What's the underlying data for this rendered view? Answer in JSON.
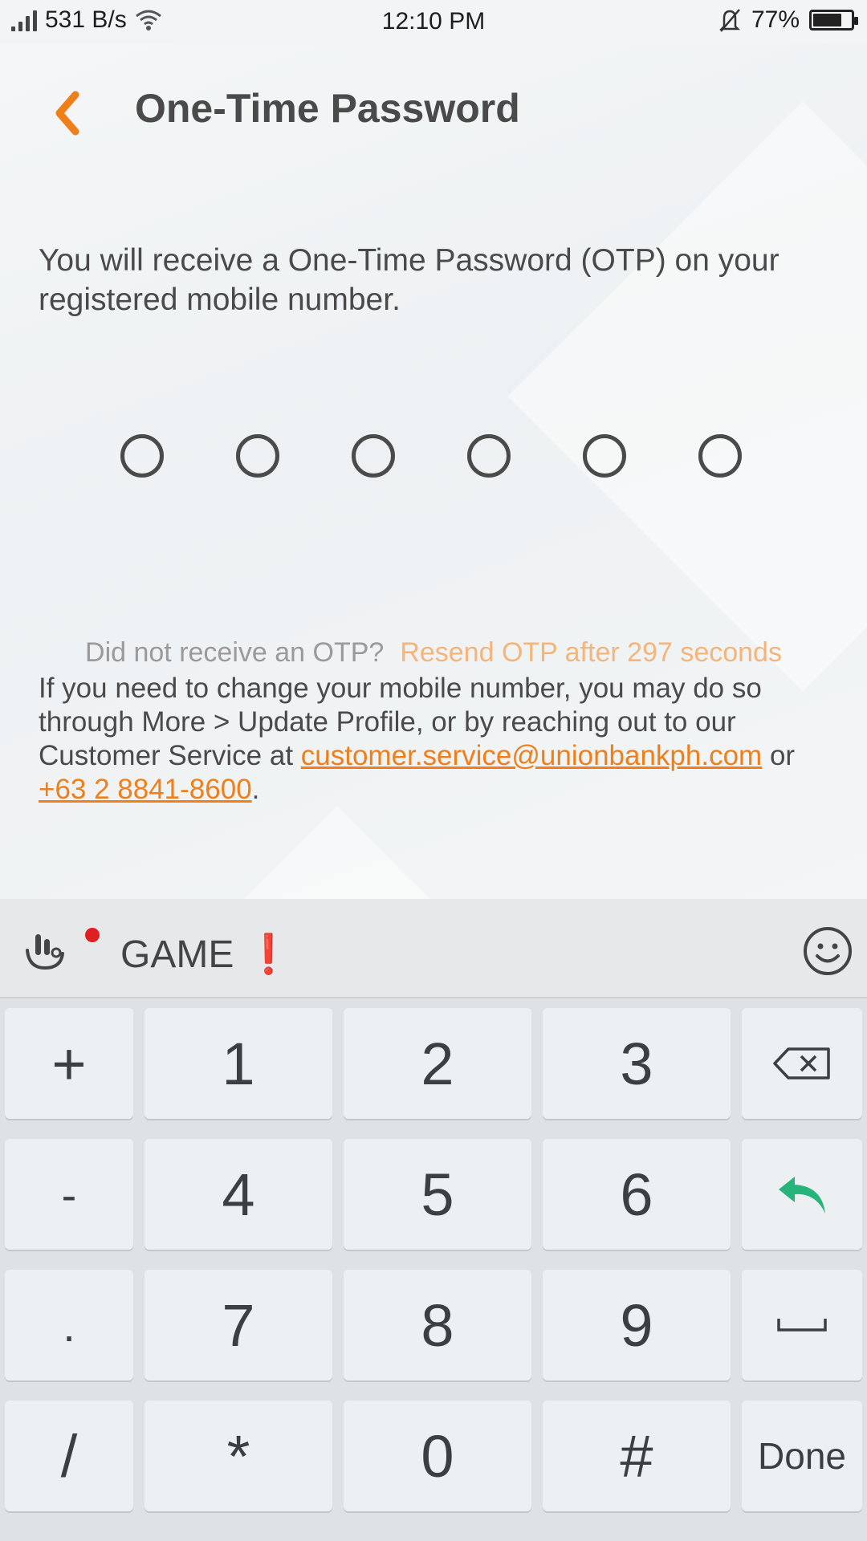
{
  "status_bar": {
    "network_speed": "531 B/s",
    "time": "12:10 PM",
    "battery_percent": "77%",
    "battery_level": 0.77
  },
  "header": {
    "title": "One-Time Password",
    "back_icon": "chevron-left-icon",
    "accent_color": "#f07f1a"
  },
  "intro": {
    "text": "You will receive a One-Time Password (OTP) on your registered mobile number."
  },
  "otp": {
    "length": 6,
    "filled": 0
  },
  "resend": {
    "question": "Did not receive an OTP?",
    "link": "Resend OTP after 297 seconds"
  },
  "info": {
    "text_before": "If you need to change your mobile number, you may do so through More > Update Profile, or by reaching out to our Customer Service at ",
    "email": "customer.service@unionbankph.com",
    "text_middle": " or ",
    "phone": "+63 2 8841-8600",
    "text_after": "."
  },
  "keyboard": {
    "toolbar": {
      "game_label": "GAME",
      "game_mark": "❗",
      "gesture_icon": "gesture-icon",
      "emoji_icon": "emoji-icon"
    },
    "keys": {
      "plus": "+",
      "one": "1",
      "two": "2",
      "three": "3",
      "minus": "-",
      "four": "4",
      "five": "5",
      "six": "6",
      "period": ".",
      "seven": "7",
      "eight": "8",
      "nine": "9",
      "slash": "/",
      "star": "*",
      "zero": "0",
      "hash": "#",
      "done": "Done"
    },
    "icons": {
      "backspace": "backspace-icon",
      "enter": "enter-icon",
      "space": "space-icon"
    },
    "enter_color": "#27b47a"
  }
}
